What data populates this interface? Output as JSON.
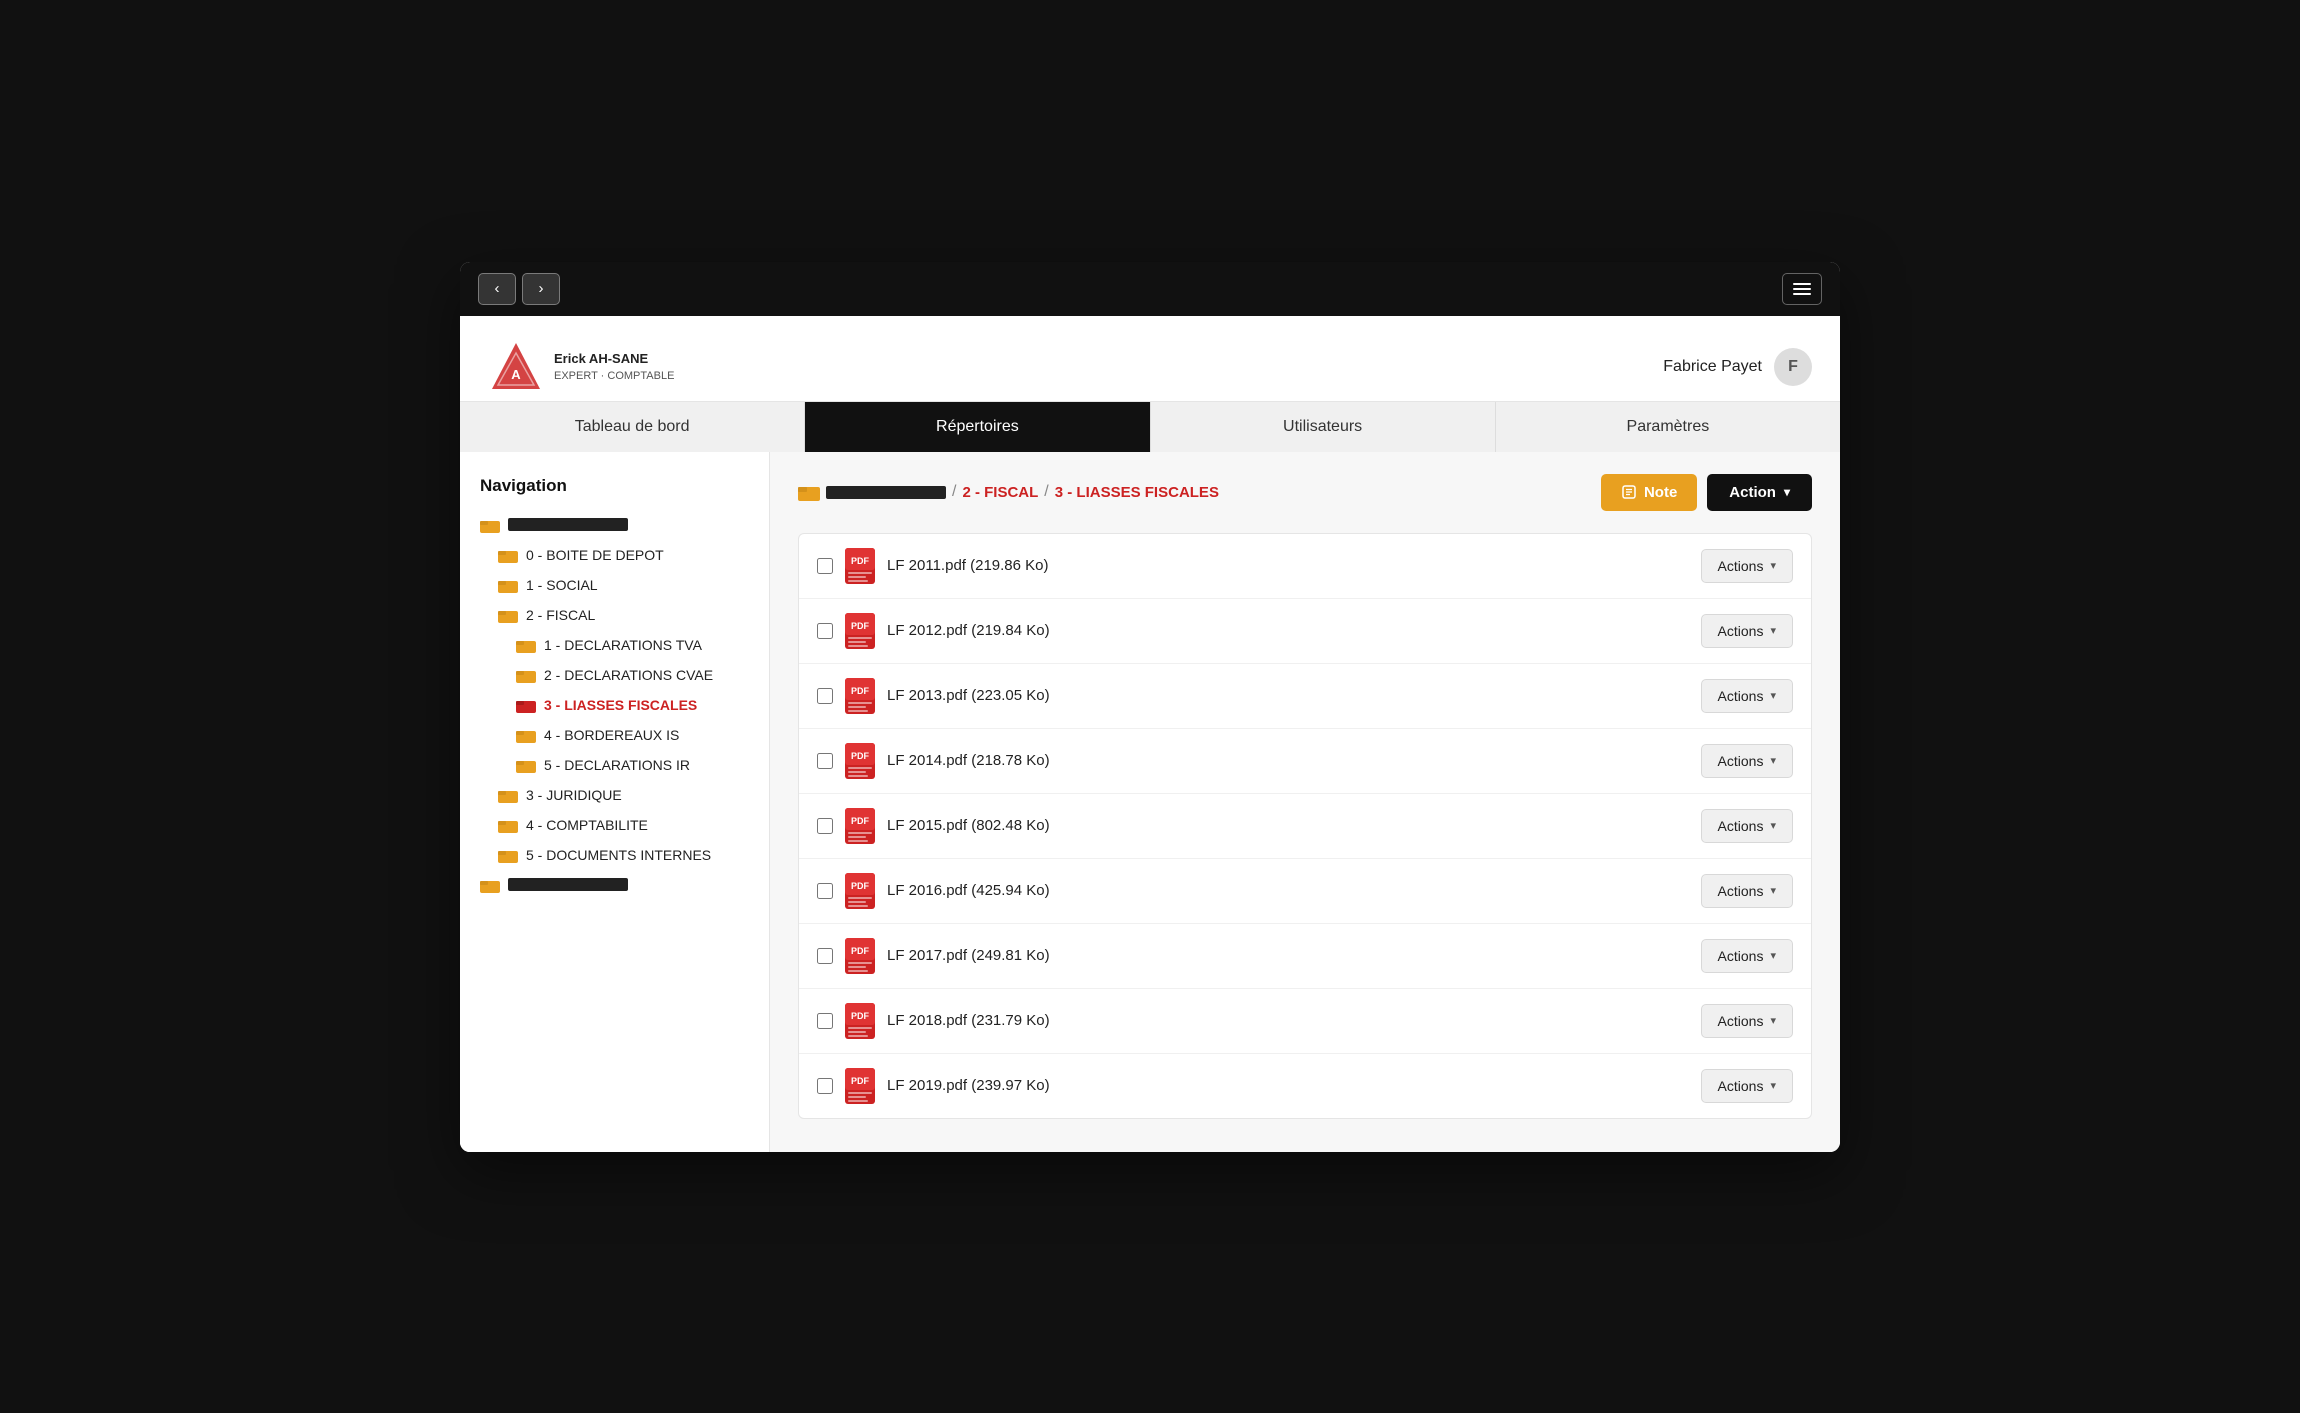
{
  "window": {
    "title": "Erick AH-SANE Expert Comptable"
  },
  "titlebar": {
    "back_label": "‹",
    "forward_label": "›",
    "menu_label": "menu"
  },
  "header": {
    "logo_name": "Erick AH-SANE",
    "logo_subtitle": "EXPERT · COMPTABLE",
    "user_name": "Fabrice Payet",
    "user_initial": "F"
  },
  "tabs": [
    {
      "id": "dashboard",
      "label": "Tableau de bord",
      "active": false
    },
    {
      "id": "repertoires",
      "label": "Répertoires",
      "active": true
    },
    {
      "id": "utilisateurs",
      "label": "Utilisateurs",
      "active": false
    },
    {
      "id": "parametres",
      "label": "Paramètres",
      "active": false
    }
  ],
  "sidebar": {
    "title": "Navigation",
    "items": [
      {
        "id": "root",
        "label": "",
        "redacted": true,
        "level": 0
      },
      {
        "id": "boite",
        "label": "0 - BOITE DE DEPOT",
        "level": 1
      },
      {
        "id": "social",
        "label": "1 - SOCIAL",
        "level": 1
      },
      {
        "id": "fiscal",
        "label": "2 - FISCAL",
        "level": 1
      },
      {
        "id": "declarations-tva",
        "label": "1 - DECLARATIONS TVA",
        "level": 2
      },
      {
        "id": "declarations-cvae",
        "label": "2 - DECLARATIONS CVAE",
        "level": 2
      },
      {
        "id": "liasses-fiscales",
        "label": "3 - LIASSES FISCALES",
        "level": 2,
        "active": true
      },
      {
        "id": "bordereaux-is",
        "label": "4 - BORDEREAUX IS",
        "level": 2
      },
      {
        "id": "declarations-ir",
        "label": "5 - DECLARATIONS IR",
        "level": 2
      },
      {
        "id": "juridique",
        "label": "3 - JURIDIQUE",
        "level": 1
      },
      {
        "id": "comptabilite",
        "label": "4 - COMPTABILITE",
        "level": 1
      },
      {
        "id": "documents-internes",
        "label": "5 - DOCUMENTS INTERNES",
        "level": 1
      },
      {
        "id": "bottom",
        "label": "",
        "redacted": true,
        "level": 0
      }
    ]
  },
  "breadcrumb": {
    "root_redacted": true,
    "fiscal": "2 - FISCAL",
    "current": "3 - LIASSES FISCALES",
    "sep": "/"
  },
  "toolbar": {
    "note_label": "Note",
    "action_label": "Action"
  },
  "files": [
    {
      "id": "lf2011",
      "name": "LF 2011.pdf (219.86 Ko)"
    },
    {
      "id": "lf2012",
      "name": "LF 2012.pdf (219.84 Ko)"
    },
    {
      "id": "lf2013",
      "name": "LF 2013.pdf (223.05 Ko)"
    },
    {
      "id": "lf2014",
      "name": "LF 2014.pdf (218.78 Ko)"
    },
    {
      "id": "lf2015",
      "name": "LF 2015.pdf (802.48 Ko)"
    },
    {
      "id": "lf2016",
      "name": "LF 2016.pdf (425.94 Ko)"
    },
    {
      "id": "lf2017",
      "name": "LF 2017.pdf (249.81 Ko)"
    },
    {
      "id": "lf2018",
      "name": "LF 2018.pdf (231.79 Ko)"
    },
    {
      "id": "lf2019",
      "name": "LF 2019.pdf (239.97 Ko)"
    }
  ],
  "actions_label": "Actions",
  "colors": {
    "accent_red": "#cc2222",
    "accent_gold": "#e8a020",
    "black": "#111111"
  }
}
